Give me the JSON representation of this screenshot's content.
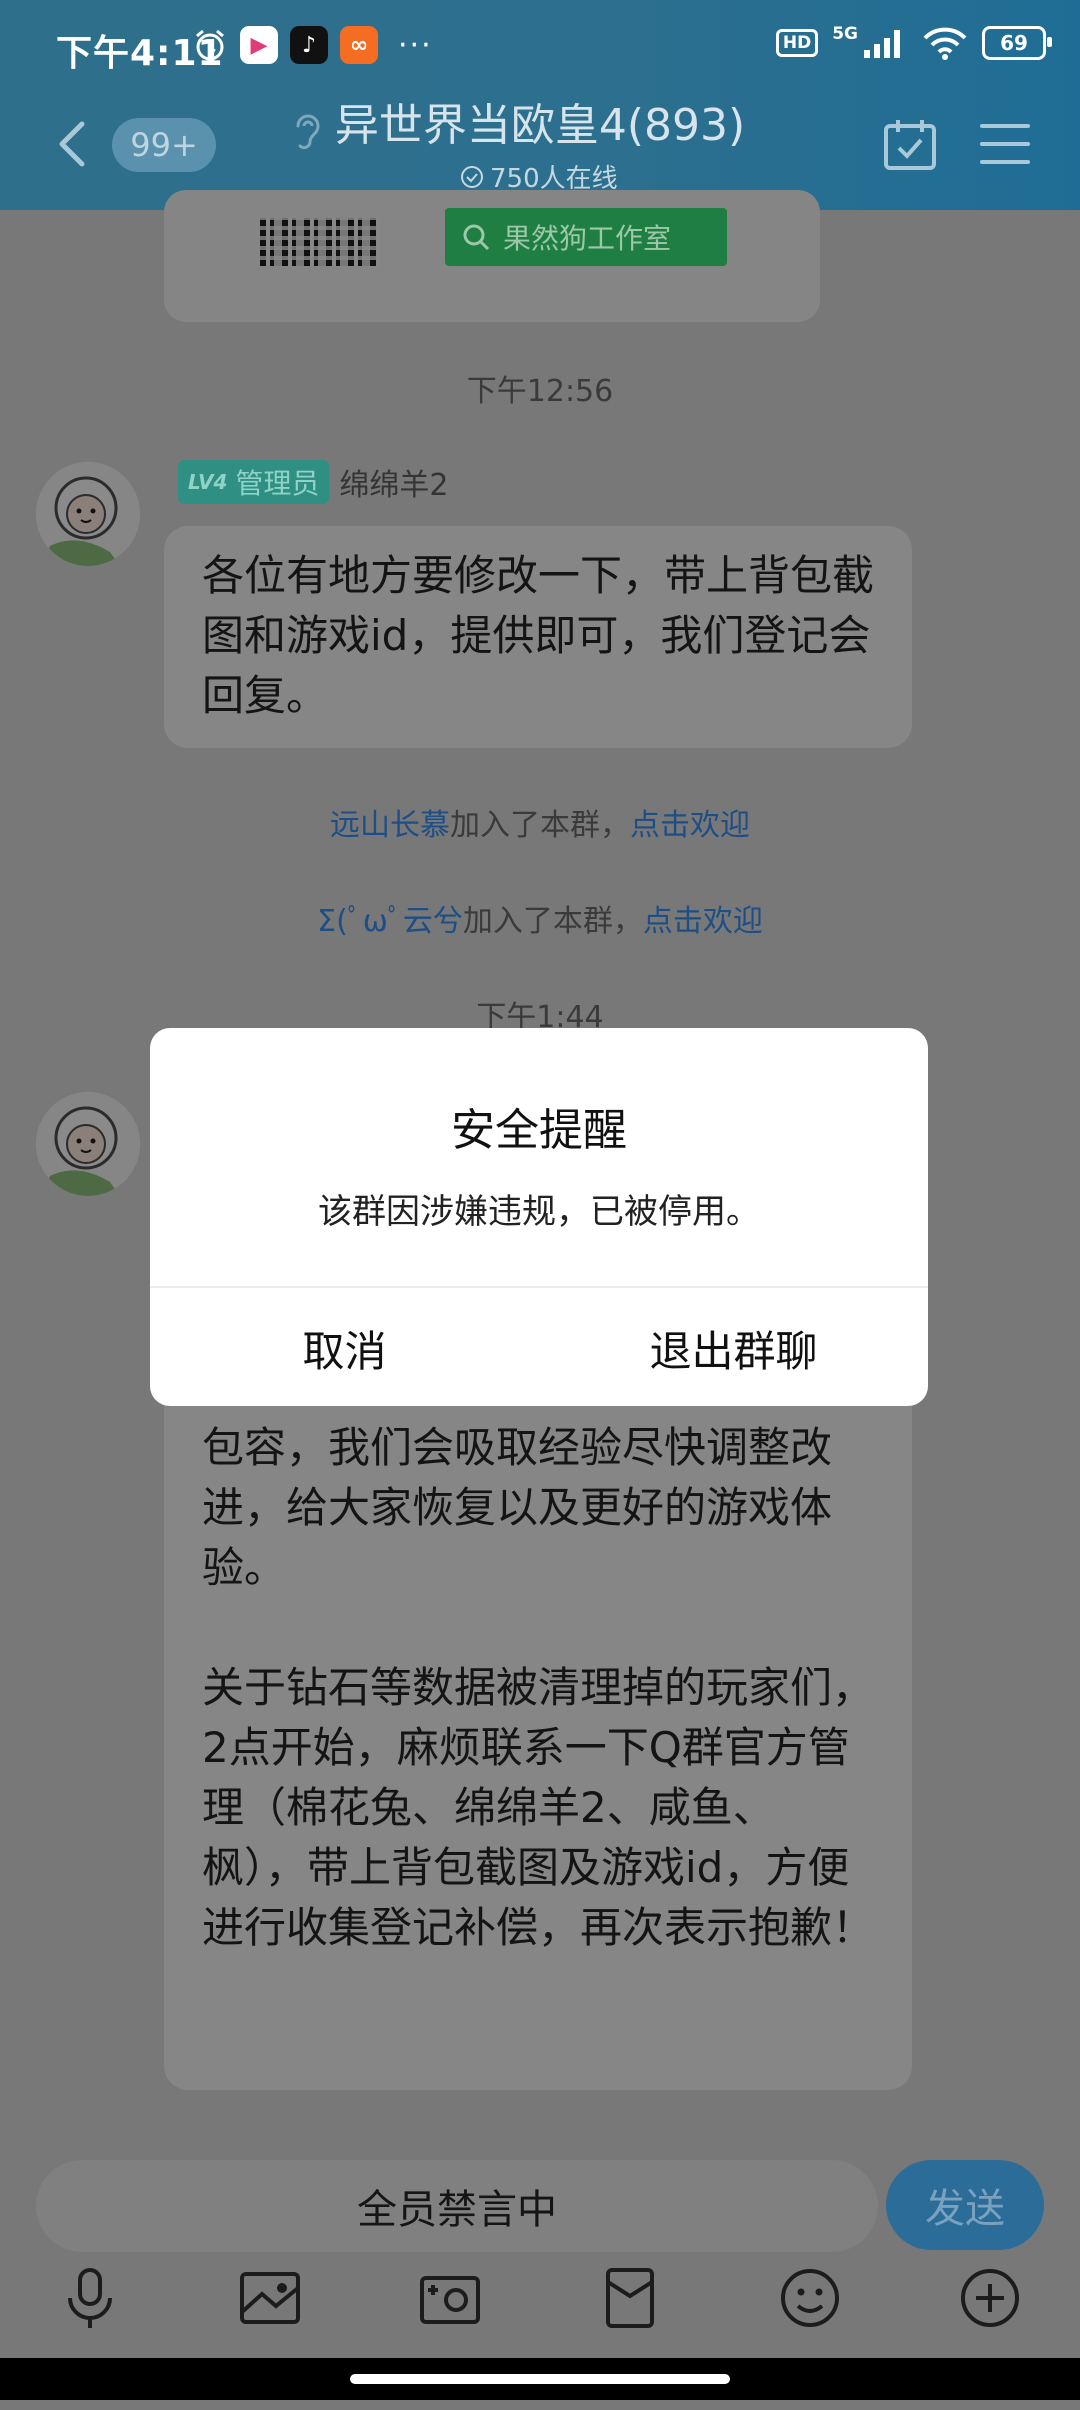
{
  "status_bar": {
    "time": "下午4:11",
    "network": "5G",
    "hd": "HD",
    "battery": "69"
  },
  "header": {
    "unread_count": "99+",
    "group_title": "异世界当欧皇4(893)",
    "online_text": "750人在线"
  },
  "shared_card": {
    "search_label": "果然狗工作室"
  },
  "messages": {
    "time_1": "下午12:56",
    "sender_badge_level": "LV4",
    "sender_badge_role": "管理员",
    "sender_name": "绵绵羊2",
    "bubble_1": "各位有地方要修改一下，带上背包截图和游戏id，提供即可，我们登记会回复。",
    "join_1_user": "远山长慕",
    "join_1_text": "加入了本群，",
    "join_1_link": "点击欢迎",
    "join_2_user": "Σ(ﾟωﾟ云兮",
    "join_2_text": "加入了本群，",
    "join_2_link": "点击欢迎",
    "time_2": "下午1:44",
    "bubble_2_p1": "能给一些些我们调整的时间和失误的包容，我们会吸取经验尽快调整改进，给大家恢复以及更好的游戏体验。",
    "bubble_2_p2": "关于钻石等数据被清理掉的玩家们，2点开始，麻烦联系一下Q群官方管理（棉花兔、绵绵羊2、咸鱼、枫），带上背包截图及游戏id，方便进行收集登记补偿，再次表示抱歉！"
  },
  "input": {
    "muted_text": "全员禁言中",
    "send_label": "发送"
  },
  "toolbar": [
    "mic-icon",
    "image-icon",
    "camera-icon",
    "red-packet-icon",
    "emoji-icon",
    "plus-icon"
  ],
  "dialog": {
    "title": "安全提醒",
    "message": "该群因涉嫌违规，已被停用。",
    "cancel_label": "取消",
    "exit_label": "退出群聊"
  }
}
